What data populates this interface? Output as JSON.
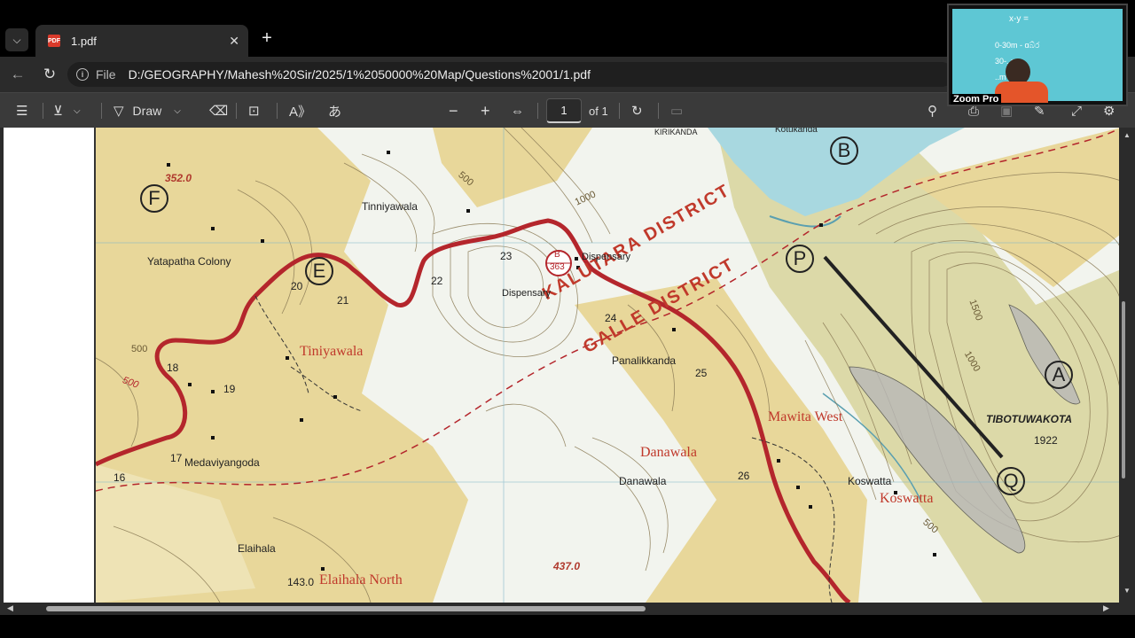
{
  "tab": {
    "title": "1.pdf"
  },
  "address": {
    "scheme_label": "File",
    "url": "D:/GEOGRAPHY/Mahesh%20Sir/2025/1%2050000%20Map/Questions%2001/1.pdf"
  },
  "toolbar": {
    "draw_label": "Draw",
    "page_number": "1",
    "page_total": "of 1"
  },
  "zoom": {
    "label": "Zoom Pro",
    "board_lines": [
      "x-y =",
      "0-30m - ɑබ්ර",
      "30-..m -",
      "..m -"
    ]
  },
  "map": {
    "circle_labels": [
      "F",
      "E",
      "B",
      "P",
      "A",
      "Q"
    ],
    "district_labels": [
      "KALUTARA DISTRICT",
      "GALLE DISTRICT"
    ],
    "place_names_black": [
      "Tinniyawala",
      "Yatapatha Colony",
      "Dispensary",
      "Dispensary",
      "Panalikkanda",
      "Medaviyangoda",
      "Danawala",
      "Koswatta",
      "Elaihala",
      "TIBOTUWAKOTA"
    ],
    "place_names_red": [
      "Tiniyawala",
      "Danawala",
      "Mawita West",
      "Koswatta",
      "Elaihala North"
    ],
    "road_numbers": [
      "16",
      "17",
      "18",
      "19",
      "20",
      "21",
      "22",
      "23",
      "24",
      "25",
      "26"
    ],
    "spot_heights": [
      "352.0",
      "437.0",
      "143.0",
      "1922"
    ],
    "contour_labels": [
      "500",
      "1000",
      "500",
      "1500",
      "1000",
      "500",
      "500"
    ],
    "route_shield": [
      "B",
      "363"
    ],
    "top_cut_text": [
      "KIRIKANDA",
      "Kotukanda"
    ]
  },
  "colors": {
    "map_yellow": "#e8d79a",
    "map_white": "#f2f4ee",
    "road_red": "#b4262c",
    "contour": "#8a7a55",
    "district_red": "#c0392b"
  }
}
